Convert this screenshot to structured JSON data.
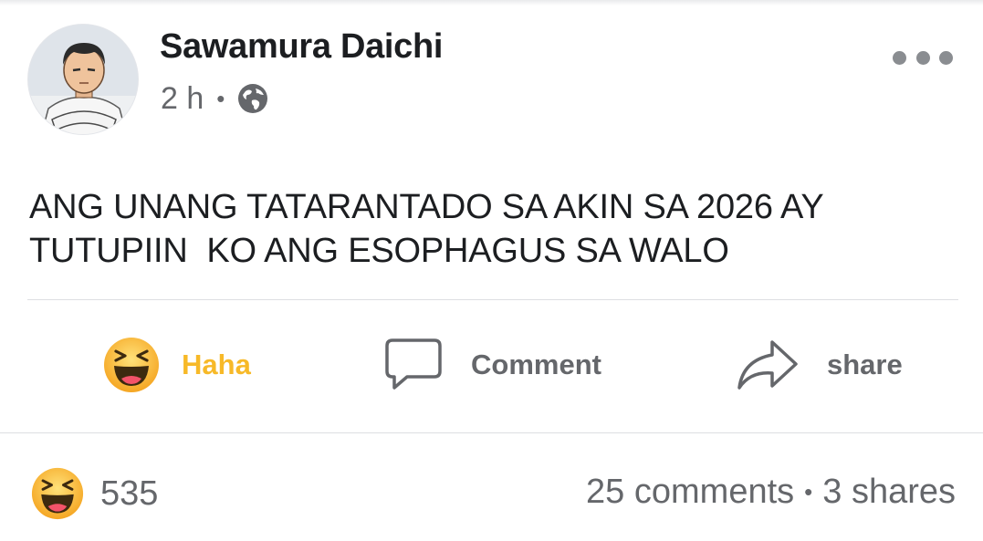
{
  "post": {
    "author": "Sawamura Daichi",
    "time": "2 h",
    "meta_separator": "•",
    "privacy_icon": "globe-icon",
    "text": "ANG UNANG TATARANTADO SA AKIN SA 2026 AY\nTUTUPIIN  KO ANG ESOPHAGUS SA WALO"
  },
  "actions": {
    "reaction_label": "Haha",
    "comment_label": "Comment",
    "share_label": "share"
  },
  "stats": {
    "reaction_count": "535",
    "comments": "25 comments",
    "separator": "•",
    "shares": "3 shares"
  },
  "colors": {
    "haha": "#f7b928",
    "secondary_text": "#65676b",
    "primary_text": "#1c1e21",
    "divider": "#dddfe2"
  }
}
